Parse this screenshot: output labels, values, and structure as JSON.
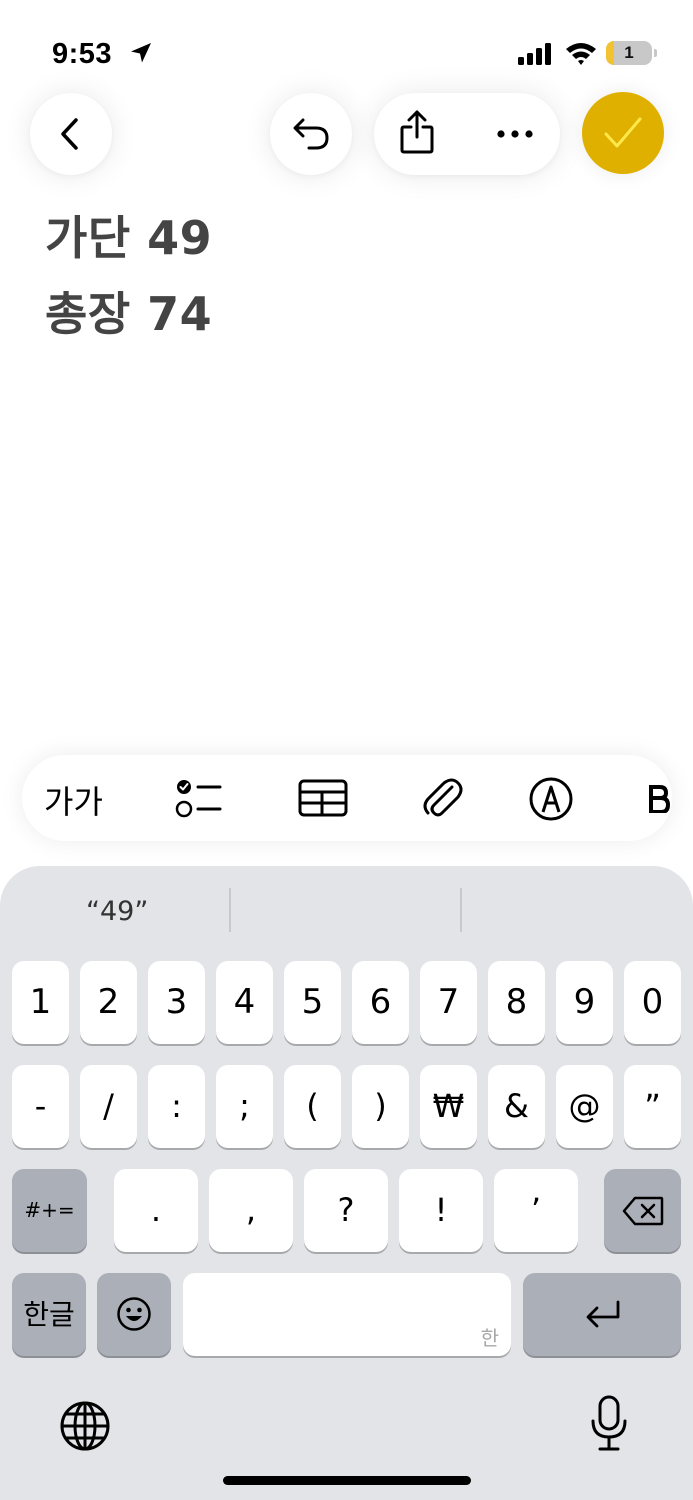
{
  "status_bar": {
    "time": "9:53",
    "battery_level": "1"
  },
  "note": {
    "lines": [
      "가단 49",
      "총장 74"
    ]
  },
  "format_toolbar": {
    "text_style_label": "가가"
  },
  "keyboard": {
    "suggestion": "“49”",
    "number_row": [
      "1",
      "2",
      "3",
      "4",
      "5",
      "6",
      "7",
      "8",
      "9",
      "0"
    ],
    "symbol_row": [
      "-",
      "/",
      ":",
      ";",
      "(",
      ")",
      "₩",
      "&",
      "@",
      "”"
    ],
    "third_row": {
      "more_symbols": "#+=",
      "keys": [
        ".",
        ",",
        "?",
        "!",
        "’"
      ]
    },
    "bottom_row": {
      "language_key": "한글",
      "space_hint": "한"
    }
  },
  "colors": {
    "accent": "#e0b000",
    "check": "#ffe94a",
    "keyboard_bg": "#e3e4e8",
    "note_text": "#444444"
  }
}
